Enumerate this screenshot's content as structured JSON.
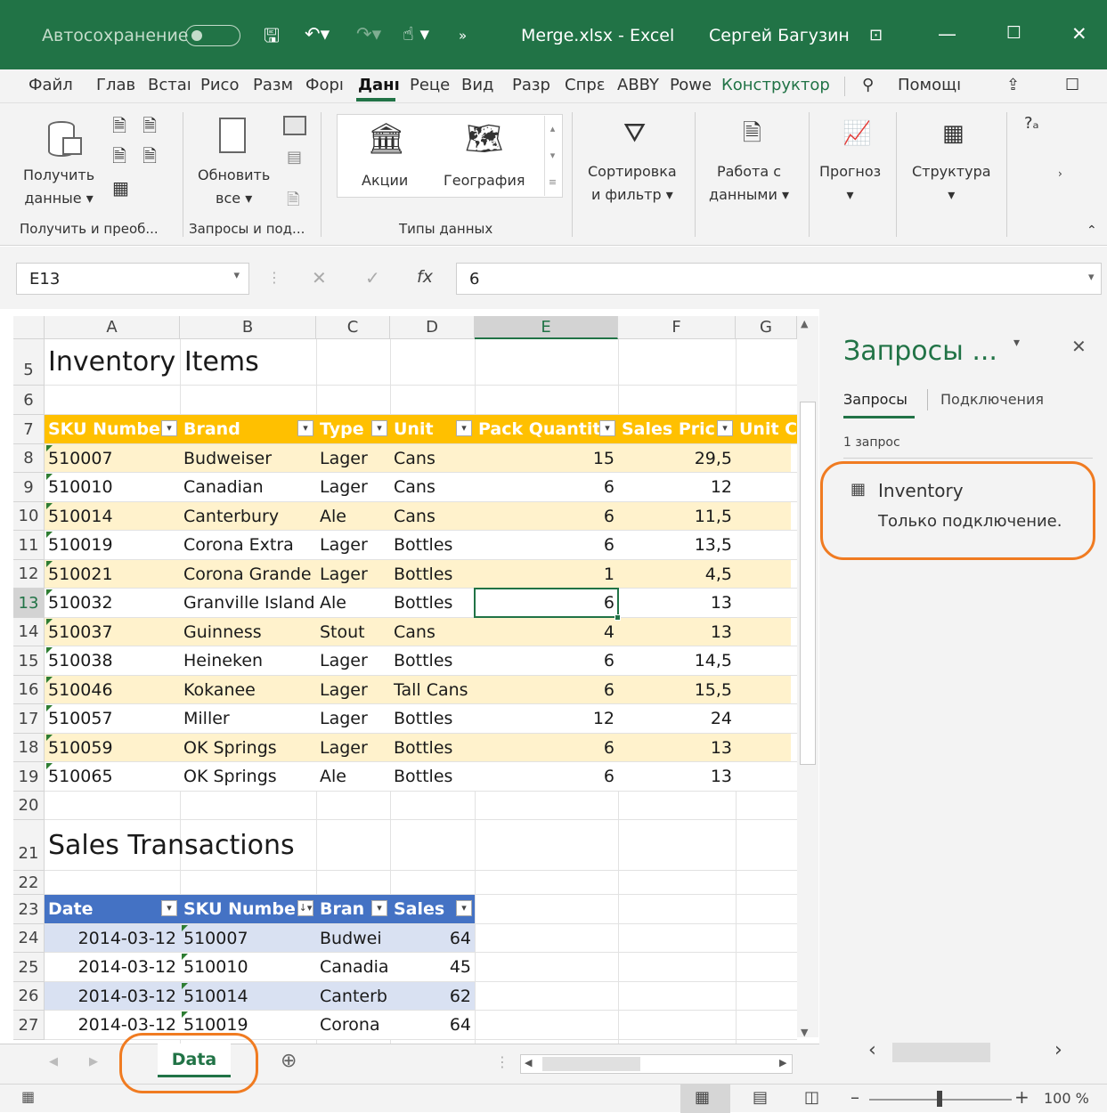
{
  "titlebar": {
    "autosave": "Автосохранение",
    "filename": "Merge.xlsx  -  Excel",
    "user": "Сергей Багузин"
  },
  "menu": [
    "Файл",
    "Глав",
    "Встаı",
    "Рисо",
    "Разм",
    "Форı",
    "Данı",
    "Реце",
    "Вид",
    "Разр",
    "Спрε",
    "ABBY",
    "Powe",
    "Конструктор"
  ],
  "menu_search": "Помощı",
  "ribbon": {
    "get_data": [
      "Получить",
      "данные ▾"
    ],
    "refresh": [
      "Обновить",
      "все ▾"
    ],
    "stocks": "Акции",
    "geography": "География",
    "sort": [
      "Сортировка",
      "и фильтр ▾"
    ],
    "work": [
      "Работа с",
      "данными ▾"
    ],
    "forecast": "Прогноз",
    "outline": "Структура",
    "groups": [
      "Получить и преоб...",
      "Запросы и под...",
      "Типы данных"
    ]
  },
  "formula": {
    "cell": "E13",
    "value": "6"
  },
  "columns": [
    "A",
    "B",
    "C",
    "D",
    "E",
    "F",
    "G"
  ],
  "sections": {
    "inventory_title": "Inventory Items",
    "sales_title": "Sales Transactions"
  },
  "inventory": {
    "headers": [
      "SKU Numbe",
      "Brand",
      "Type",
      "Unit",
      "Pack Quantit",
      "Sales Pric",
      "Unit C"
    ],
    "rows": [
      [
        "510007",
        "Budweiser",
        "Lager",
        "Cans",
        "15",
        "29,5"
      ],
      [
        "510010",
        "Canadian",
        "Lager",
        "Cans",
        "6",
        "12"
      ],
      [
        "510014",
        "Canterbury",
        "Ale",
        "Cans",
        "6",
        "11,5"
      ],
      [
        "510019",
        "Corona Extra",
        "Lager",
        "Bottles",
        "6",
        "13,5"
      ],
      [
        "510021",
        "Corona Grande",
        "Lager",
        "Bottles",
        "1",
        "4,5"
      ],
      [
        "510032",
        "Granville Island",
        "Ale",
        "Bottles",
        "6",
        "13"
      ],
      [
        "510037",
        "Guinness",
        "Stout",
        "Cans",
        "4",
        "13"
      ],
      [
        "510038",
        "Heineken",
        "Lager",
        "Bottles",
        "6",
        "14,5"
      ],
      [
        "510046",
        "Kokanee",
        "Lager",
        "Tall Cans",
        "6",
        "15,5"
      ],
      [
        "510057",
        "Miller",
        "Lager",
        "Bottles",
        "12",
        "24"
      ],
      [
        "510059",
        "OK Springs",
        "Lager",
        "Bottles",
        "6",
        "13"
      ],
      [
        "510065",
        "OK Springs",
        "Ale",
        "Bottles",
        "6",
        "13"
      ]
    ]
  },
  "sales": {
    "headers": [
      "Date",
      "SKU Numbe",
      "Bran",
      "Sales"
    ],
    "rows": [
      [
        "2014-03-12",
        "510007",
        "Budwei",
        "64"
      ],
      [
        "2014-03-12",
        "510010",
        "Canadia",
        "45"
      ],
      [
        "2014-03-12",
        "510014",
        "Canterb",
        "62"
      ],
      [
        "2014-03-12",
        "510019",
        "Corona",
        "64"
      ]
    ]
  },
  "row_numbers": [
    "5",
    "6",
    "7",
    "8",
    "9",
    "10",
    "11",
    "12",
    "13",
    "14",
    "15",
    "16",
    "17",
    "18",
    "19",
    "20",
    "21",
    "22",
    "23",
    "24",
    "25",
    "26",
    "27"
  ],
  "pane": {
    "title": "Запросы ...",
    "tab_queries": "Запросы",
    "tab_connections": "Подключения",
    "count": "1 запрос",
    "query_name": "Inventory",
    "query_status": "Только подключение."
  },
  "sheet_tab": "Data",
  "zoom": "100 %",
  "colors": {
    "excel_green": "#217346",
    "orange_header": "#ffc000",
    "orange_band": "#fff2cc",
    "blue_header": "#4472c4",
    "blue_band": "#d9e1f2",
    "callout": "#f07b21"
  }
}
